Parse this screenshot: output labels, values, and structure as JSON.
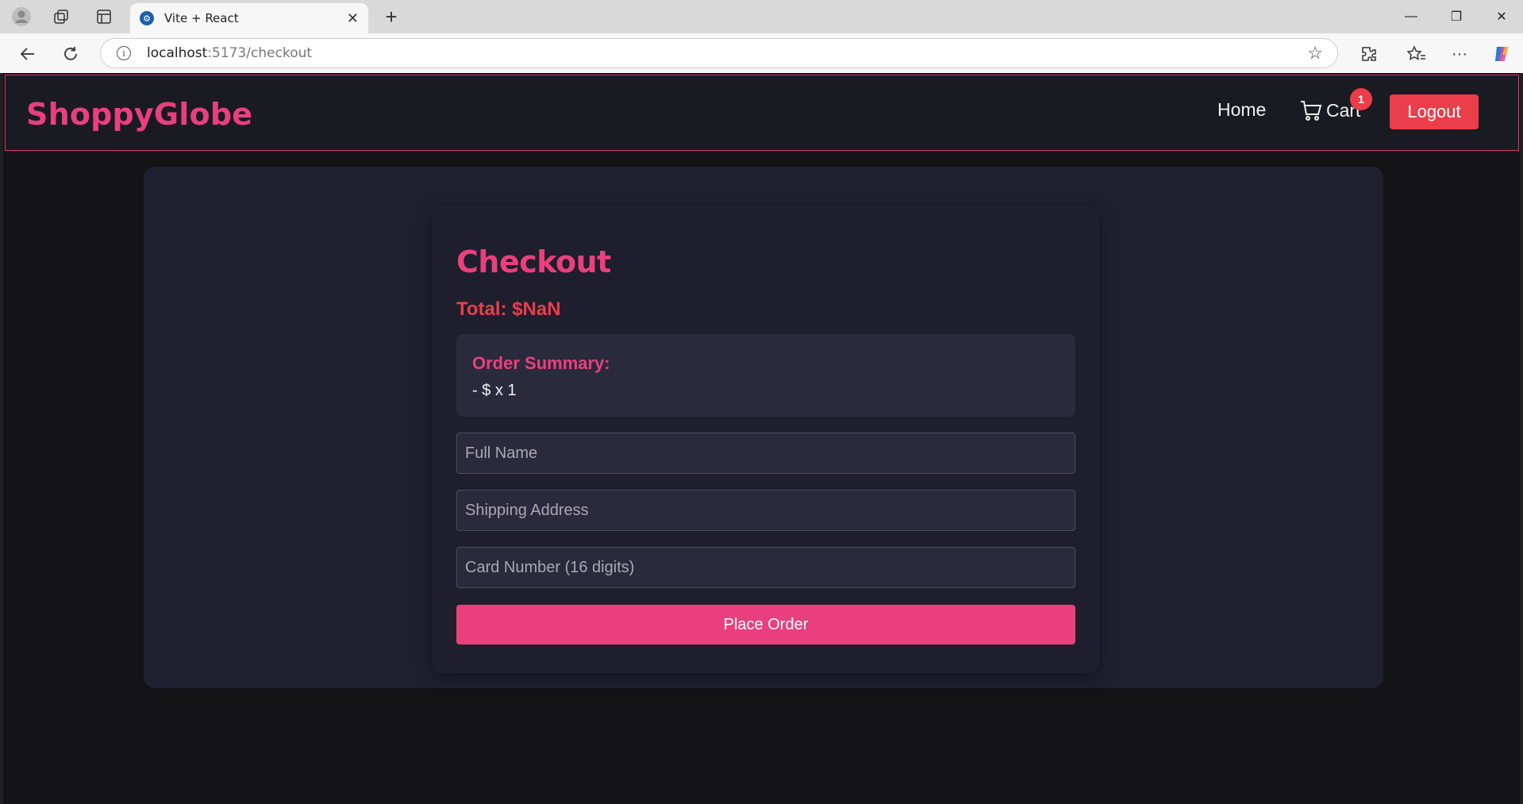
{
  "browser": {
    "tab_title": "Vite + React",
    "tab_close": "✕",
    "new_tab": "+",
    "url_host": "localhost",
    "url_path": ":5173/checkout",
    "window_controls": {
      "minimize": "—",
      "restore": "❐",
      "close": "✕"
    }
  },
  "header": {
    "brand": "ShoppyGlobe",
    "nav_home": "Home",
    "nav_cart": "Cart",
    "cart_count": "1",
    "logout": "Logout"
  },
  "checkout": {
    "title": "Checkout",
    "total": "Total: $NaN",
    "summary_title": "Order Summary:",
    "summary_items": [
      "- $ x 1"
    ],
    "full_name_placeholder": "Full Name",
    "address_placeholder": "Shipping Address",
    "card_placeholder": "Card Number (16 digits)",
    "place_order": "Place Order"
  },
  "colors": {
    "accent_pink": "#e9407d",
    "danger_red": "#ec3d4a",
    "panel_bg": "#1f1f2f",
    "page_bg": "#131315"
  }
}
